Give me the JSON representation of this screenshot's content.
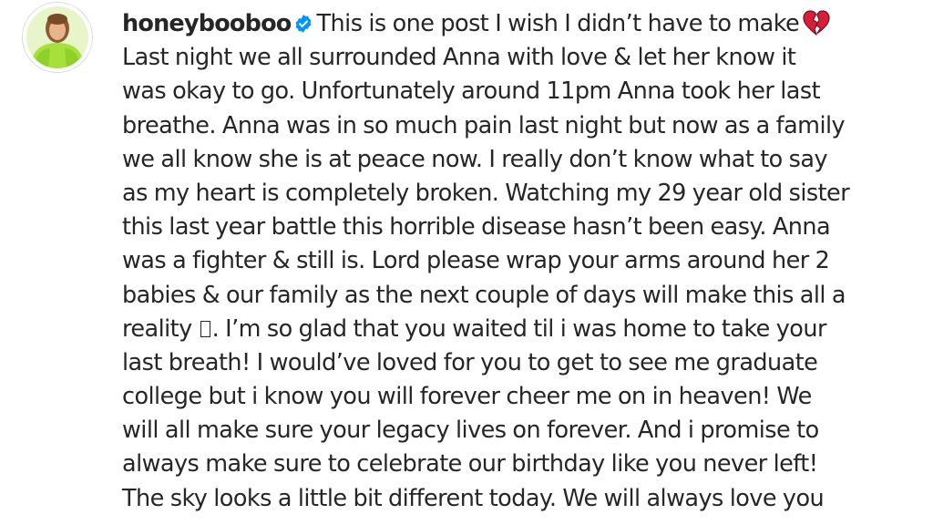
{
  "post": {
    "username": "honeybooboo",
    "verified_icon": "verified-badge-icon",
    "broken_heart_icon": "broken-heart-emoji",
    "unsupported_glyph_icon": "missing-glyph-box",
    "colors": {
      "text": "#262626",
      "verified": "#0095f6",
      "heart": "#d81f3a",
      "avatar_bg": "#b9e84a"
    },
    "caption": {
      "line1": "This is one post I wish I didn’t have to make",
      "line2": "Last night we all surrounded Anna with love & let her know it",
      "line3": "was okay to go. Unfortunately around 11pm Anna took her last",
      "line4": "breathe. Anna was in so much pain last night but now as a family",
      "line5": "we all know she is at peace now. I really don’t know what to say",
      "line6": "as my heart is completely broken. Watching my 29 year old sister",
      "line7": "this last year battle this horrible disease hasn’t been easy. Anna",
      "line8": "was a fighter & still is. Lord please wrap your arms around her 2",
      "line9": "babies & our family as the next couple of days will make this all a",
      "line10_before": "reality",
      "line10_after": ". I’m so glad that you waited til i was home to take your",
      "line11": "last breath! I would’ve loved for you to get to see me graduate",
      "line12": "college but i know you will forever cheer me on in heaven! We",
      "line13": "will all make sure your legacy lives on forever. And i promise to",
      "line14": "always make sure to celebrate our birthday like you never left!",
      "line15": "The sky looks a little bit different today. We will always love you"
    }
  }
}
